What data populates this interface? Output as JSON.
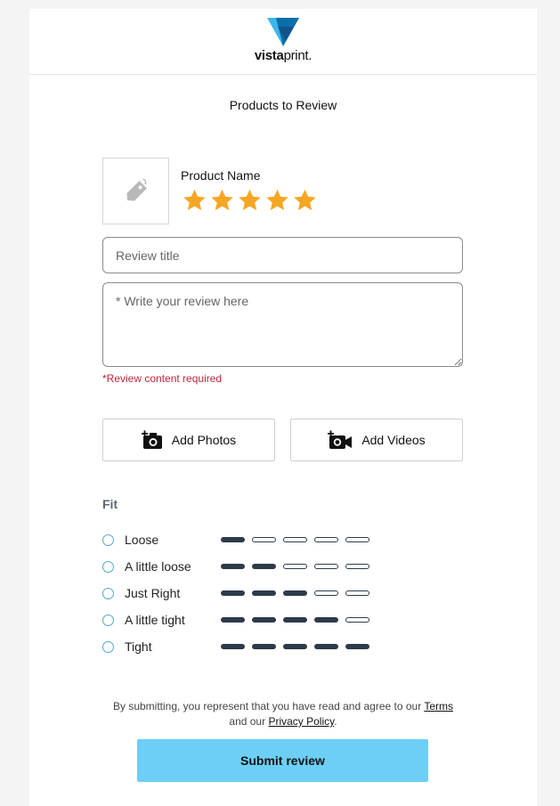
{
  "brand": {
    "logo_text_bold": "vista",
    "logo_text_light": "print",
    "logo_suffix": "."
  },
  "section_title": "Products to Review",
  "product": {
    "name": "Product Name",
    "rating": 5,
    "max_rating": 5
  },
  "review": {
    "title_placeholder": "Review title",
    "body_placeholder": "* Write your review here",
    "error_text": "*Review content required"
  },
  "media": {
    "add_photos_label": "Add Photos",
    "add_videos_label": "Add Videos"
  },
  "fit": {
    "label": "Fit",
    "options": [
      {
        "label": "Loose",
        "level": 1
      },
      {
        "label": "A little loose",
        "level": 2
      },
      {
        "label": "Just Right",
        "level": 3
      },
      {
        "label": "A little tight",
        "level": 4
      },
      {
        "label": "Tight",
        "level": 5
      }
    ],
    "scale_max": 5
  },
  "legal": {
    "text_before": "By submitting, you represent that you have read and agree to our ",
    "terms_link": "Terms",
    "text_middle": "and our ",
    "privacy_link": "Privacy Policy",
    "text_after": "."
  },
  "submit_label": "Submit review",
  "colors": {
    "star": "#f5a623",
    "accent": "#6dcff6",
    "error": "#c0233b",
    "bar": "#2d3a4a"
  }
}
